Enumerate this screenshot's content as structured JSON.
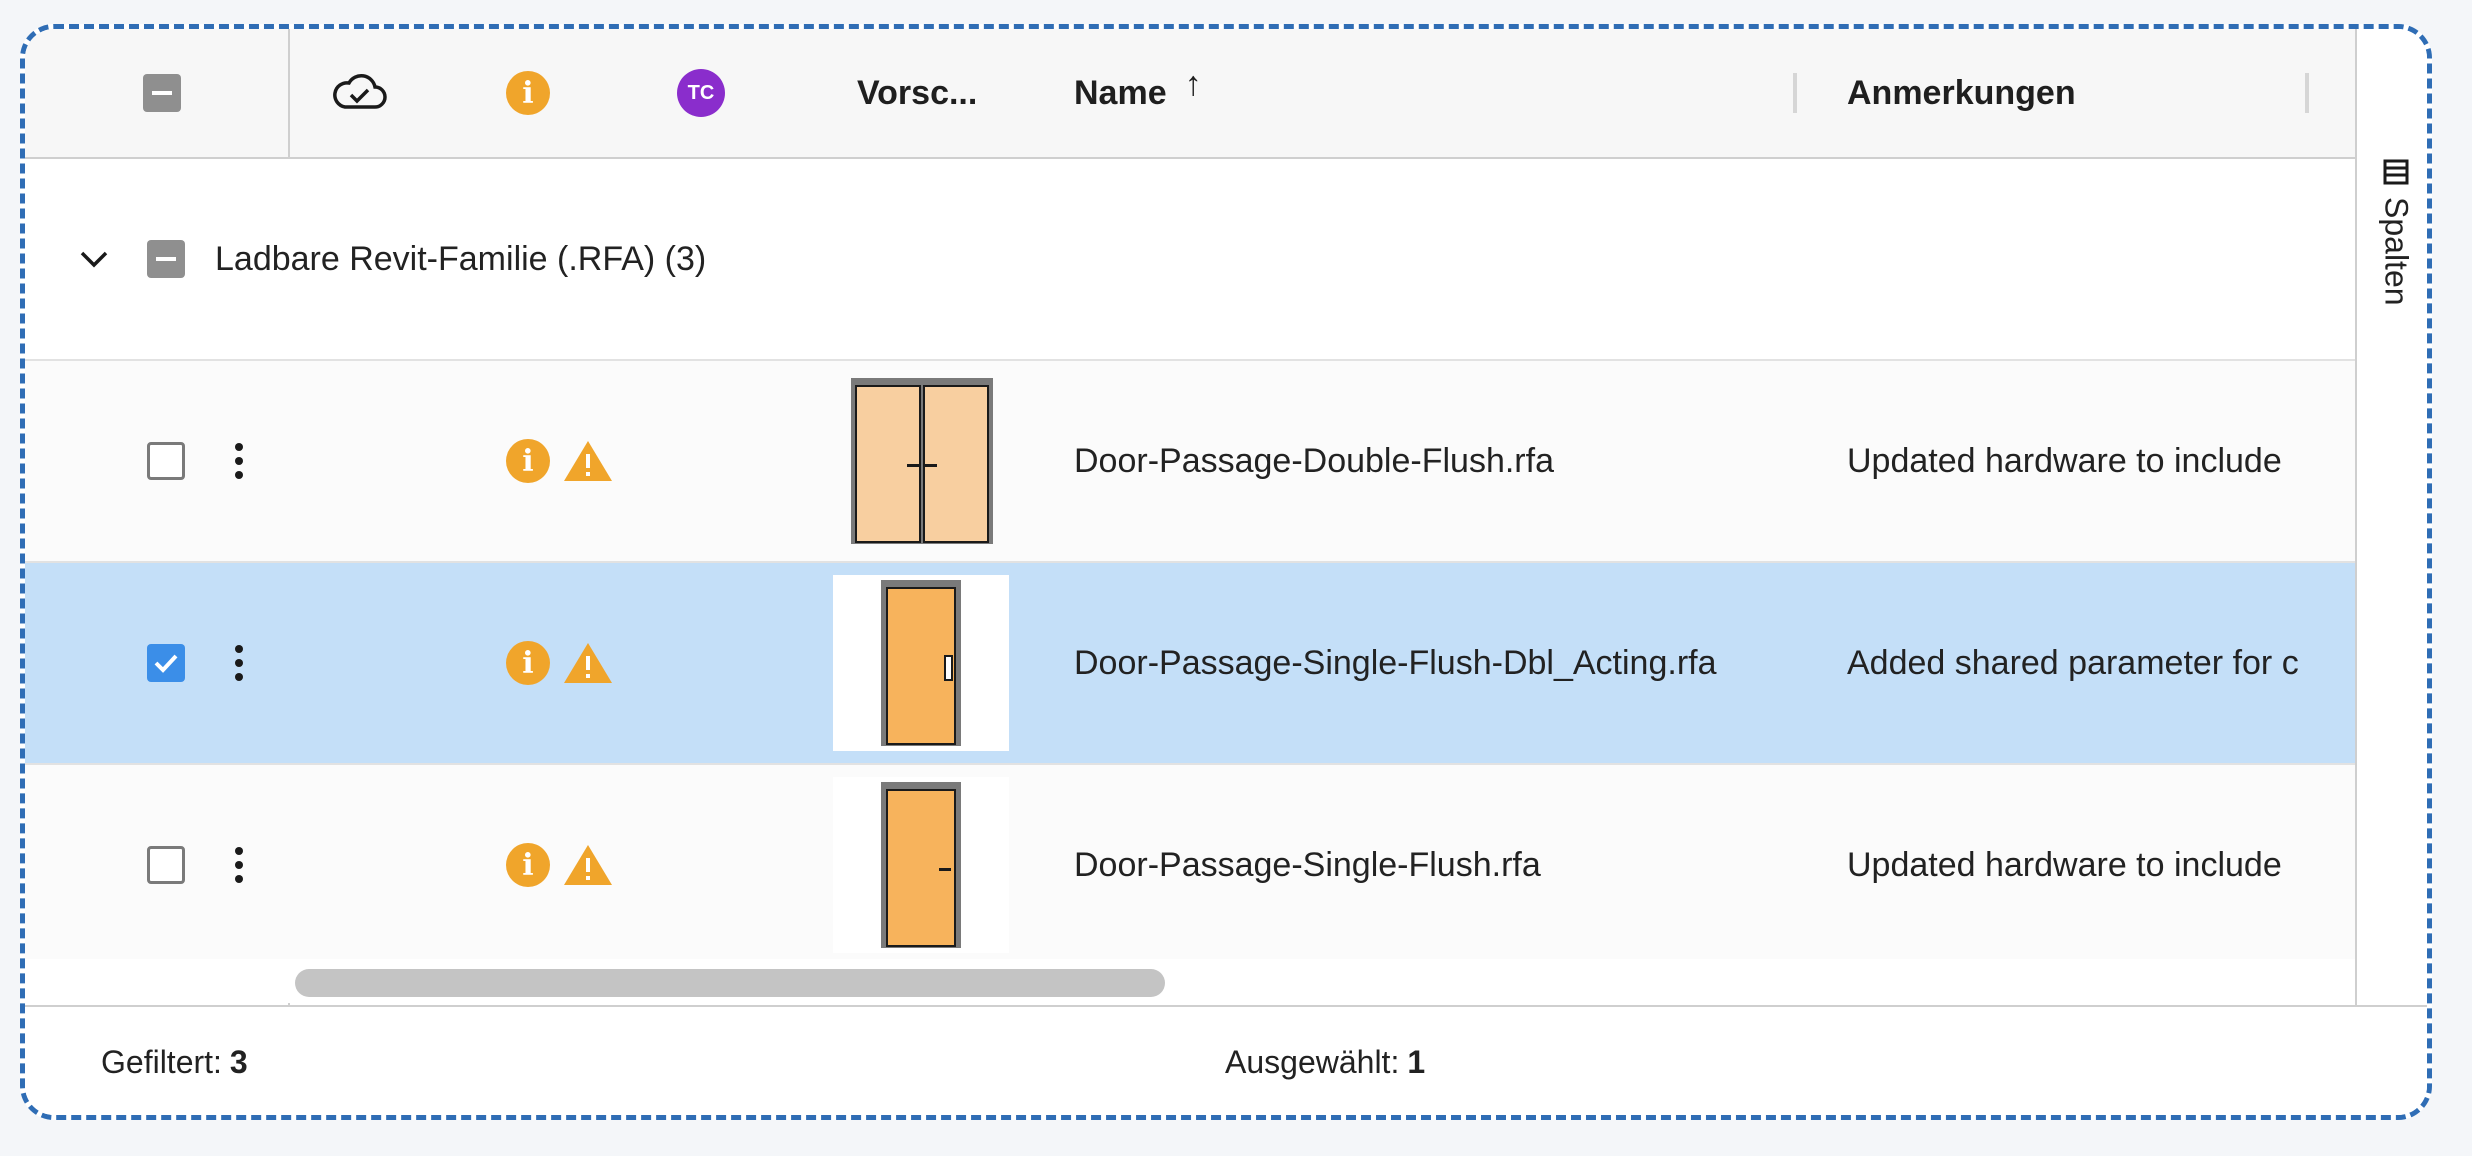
{
  "header": {
    "preview_label": "Vorsc...",
    "name_label": "Name",
    "name_sort_glyph": "↑",
    "notes_label": "Anmerkungen",
    "avatar_initials": "TC",
    "info_glyph": "i"
  },
  "group": {
    "label": "Ladbare Revit-Familie (.RFA) (3)"
  },
  "rows": [
    {
      "name": "Door-Passage-Double-Flush.rfa",
      "note": "Updated hardware to include",
      "checked": false
    },
    {
      "name": "Door-Passage-Single-Flush-Dbl_Acting.rfa",
      "note": "Added shared parameter for c",
      "checked": true
    },
    {
      "name": "Door-Passage-Single-Flush.rfa",
      "note": "Updated hardware to include",
      "checked": false
    }
  ],
  "side_panel": {
    "label": "Spalten"
  },
  "footer": {
    "filtered_label": "Gefiltert:",
    "filtered_count": "3",
    "selected_label": "Ausgewählt:",
    "selected_count": "1"
  },
  "colors": {
    "accent": "#3b8ee8",
    "selected_row": "#c4dff8",
    "warning": "#f0a52b",
    "avatar": "#8a2dcc",
    "door_fill": "#f7b35c",
    "door_light": "#f8cfa0"
  },
  "icons": {
    "cloud": "cloud-check-icon",
    "info": "info-icon",
    "warning": "warning-icon",
    "columns": "columns-icon",
    "expand": "chevron-down-icon",
    "menu": "kebab-menu-icon"
  }
}
